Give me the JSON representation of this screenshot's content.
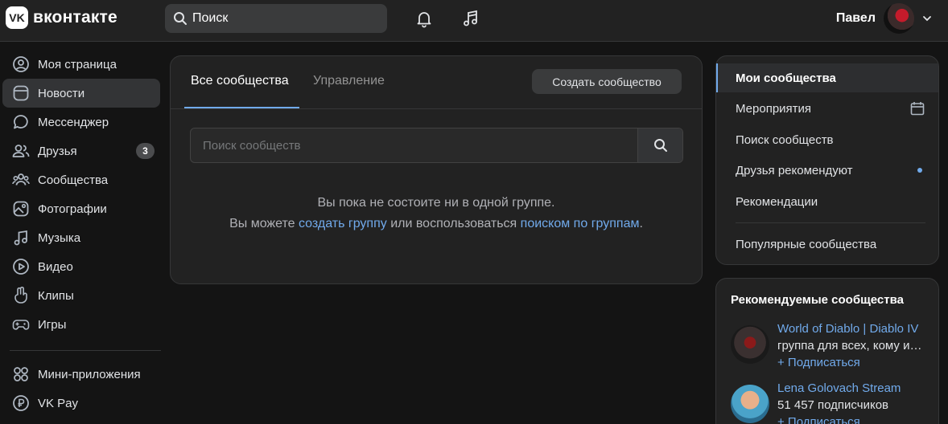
{
  "header": {
    "logo_mark": "VK",
    "logo_text": "вконтакте",
    "search_placeholder": "Поиск",
    "user_name": "Павел"
  },
  "nav": {
    "items": [
      {
        "label": "Моя страница",
        "icon": "user-circle-icon"
      },
      {
        "label": "Новости",
        "icon": "news-icon"
      },
      {
        "label": "Мессенджер",
        "icon": "message-icon"
      },
      {
        "label": "Друзья",
        "icon": "friends-icon",
        "badge": "3"
      },
      {
        "label": "Сообщества",
        "icon": "communities-icon"
      },
      {
        "label": "Фотографии",
        "icon": "photo-icon"
      },
      {
        "label": "Музыка",
        "icon": "music-icon"
      },
      {
        "label": "Видео",
        "icon": "video-icon"
      },
      {
        "label": "Клипы",
        "icon": "clips-icon"
      },
      {
        "label": "Игры",
        "icon": "gamepad-icon"
      }
    ],
    "extra": [
      {
        "label": "Мини-приложения",
        "icon": "apps-icon"
      },
      {
        "label": "VK Pay",
        "icon": "pay-icon"
      }
    ]
  },
  "main": {
    "tabs": [
      {
        "label": "Все сообщества"
      },
      {
        "label": "Управление"
      }
    ],
    "create_button": "Создать сообщество",
    "search_placeholder": "Поиск сообществ",
    "empty_line1": "Вы пока не состоите ни в одной группе.",
    "empty_prefix": "Вы можете ",
    "empty_link1": "создать группу",
    "empty_middle": " или воспользоваться ",
    "empty_link2": "поиском по группам",
    "empty_suffix": "."
  },
  "right_menu": {
    "items": [
      {
        "label": "Мои сообщества"
      },
      {
        "label": "Мероприятия"
      },
      {
        "label": "Поиск сообществ"
      },
      {
        "label": "Друзья рекомендуют"
      },
      {
        "label": "Рекомендации"
      },
      {
        "label": "Популярные сообщества"
      }
    ]
  },
  "recommended": {
    "title": "Рекомендуемые сообщества",
    "items": [
      {
        "name": "World of Diablo | Diablo IV",
        "description": "группа для всех, кому интересен Diablo",
        "subscribe": "+ Подписаться"
      },
      {
        "name": "Lena Golovach Stream",
        "description": "51 457 подписчиков",
        "subscribe": "+ Подписаться"
      }
    ]
  },
  "colors": {
    "background": "#141414",
    "card": "#222222",
    "accent": "#71aaeb",
    "text": "#e1e3e6",
    "muted": "#939393"
  }
}
